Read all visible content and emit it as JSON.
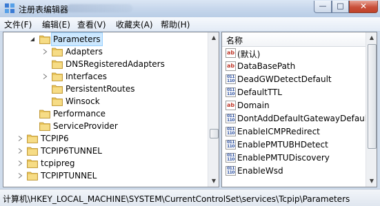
{
  "window": {
    "title": "注册表编辑器",
    "controls": {
      "minimize": "—",
      "maximize": "□",
      "close": "✕"
    }
  },
  "menu": [
    "文件(F)",
    "编辑(E)",
    "查看(V)",
    "收藏夹(A)",
    "帮助(H)"
  ],
  "tree": [
    {
      "label": "Parameters",
      "expander": "expanded",
      "selected": true
    },
    {
      "label": "Adapters",
      "expander": "collapsed"
    },
    {
      "label": "DNSRegisteredAdapters",
      "expander": "none"
    },
    {
      "label": "Interfaces",
      "expander": "collapsed"
    },
    {
      "label": "PersistentRoutes",
      "expander": "none"
    },
    {
      "label": "Winsock",
      "expander": "none"
    },
    {
      "label": "Performance",
      "expander": "none"
    },
    {
      "label": "ServiceProvider",
      "expander": "none"
    },
    {
      "label": "TCPIP6",
      "expander": "collapsed"
    },
    {
      "label": "TCPIP6TUNNEL",
      "expander": "collapsed"
    },
    {
      "label": "tcpipreg",
      "expander": "collapsed"
    },
    {
      "label": "TCPIPTUNNEL",
      "expander": "collapsed"
    }
  ],
  "list": {
    "header": "名称",
    "items": [
      {
        "name": "(默认)",
        "icon": "string-value-icon"
      },
      {
        "name": "DataBasePath",
        "icon": "string-value-icon"
      },
      {
        "name": "DeadGWDetectDefault",
        "icon": "binary-value-icon"
      },
      {
        "name": "DefaultTTL",
        "icon": "binary-value-icon"
      },
      {
        "name": "Domain",
        "icon": "string-value-icon"
      },
      {
        "name": "DontAddDefaultGatewayDefault",
        "icon": "binary-value-icon"
      },
      {
        "name": "EnableICMPRedirect",
        "icon": "binary-value-icon"
      },
      {
        "name": "EnablePMTUBHDetect",
        "icon": "binary-value-icon"
      },
      {
        "name": "EnablePMTUDiscovery",
        "icon": "binary-value-icon"
      },
      {
        "name": "EnableWsd",
        "icon": "binary-value-icon"
      }
    ]
  },
  "status": "计算机\\HKEY_LOCAL_MACHINE\\SYSTEM\\CurrentControlSet\\services\\Tcpip\\Parameters",
  "colors": {
    "selection": "#cce8ff",
    "folder": "#e8c35a",
    "string_icon": "#c0392b",
    "binary_icon": "#2b4fa0"
  }
}
